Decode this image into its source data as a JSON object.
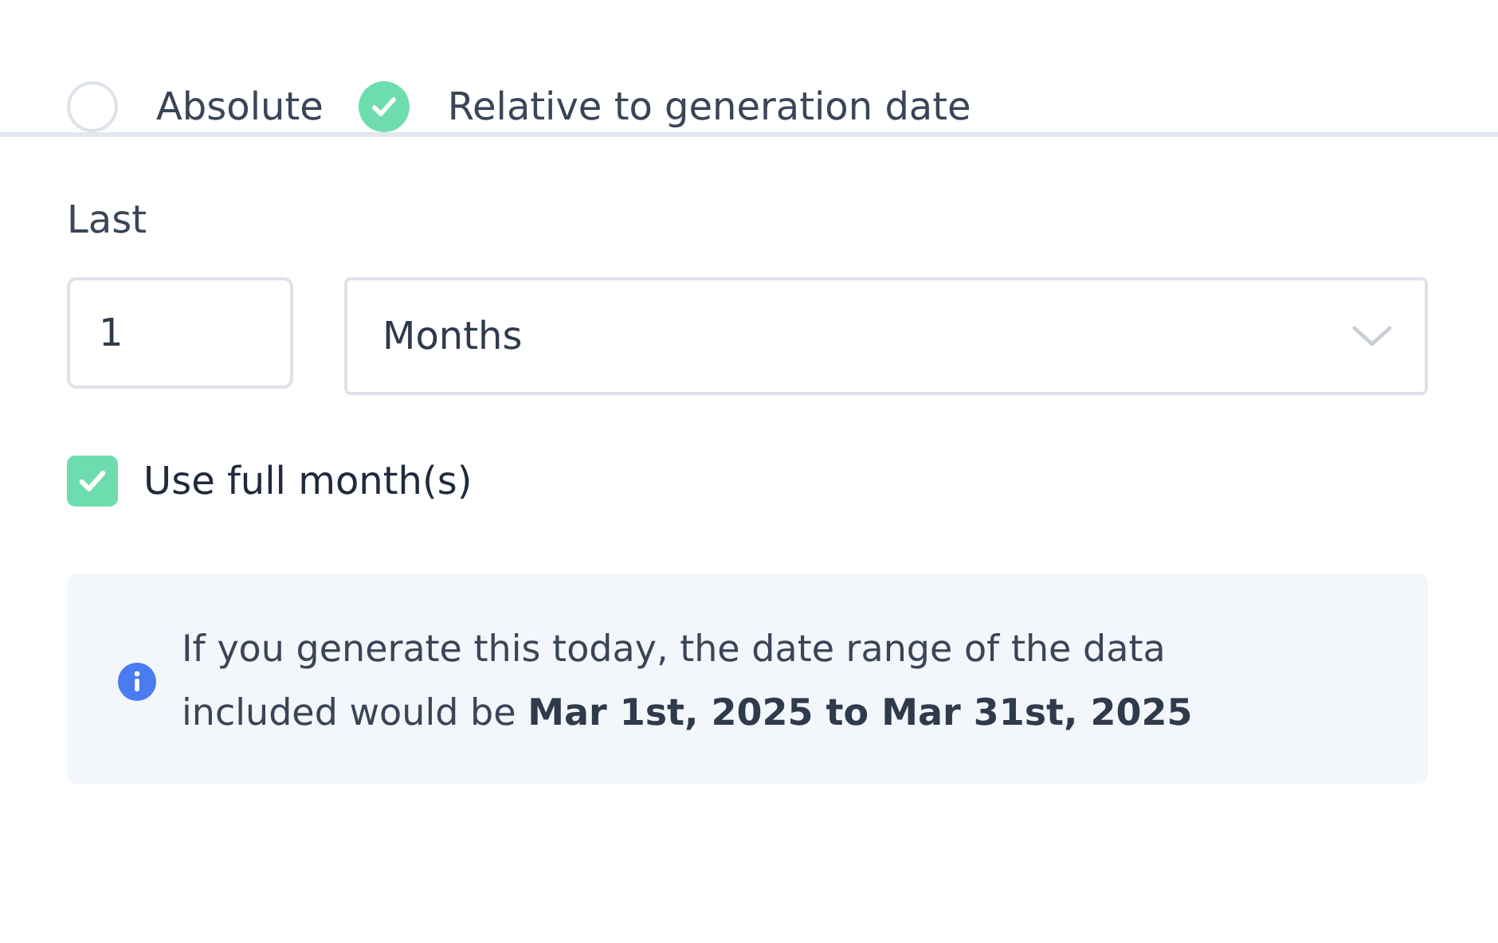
{
  "date_mode": [
    {
      "label": "Absolute",
      "selected": false
    },
    {
      "label": "Relative to generation date",
      "selected": true
    }
  ],
  "range": {
    "label": "Last",
    "amount": "1",
    "unit": "Months"
  },
  "full_month": {
    "label": "Use full month(s)",
    "checked": true
  },
  "info": {
    "text": "If you generate this today, the date range of the data included would be **Mar 1st, 2025 to Mar 31st, 2025**"
  }
}
